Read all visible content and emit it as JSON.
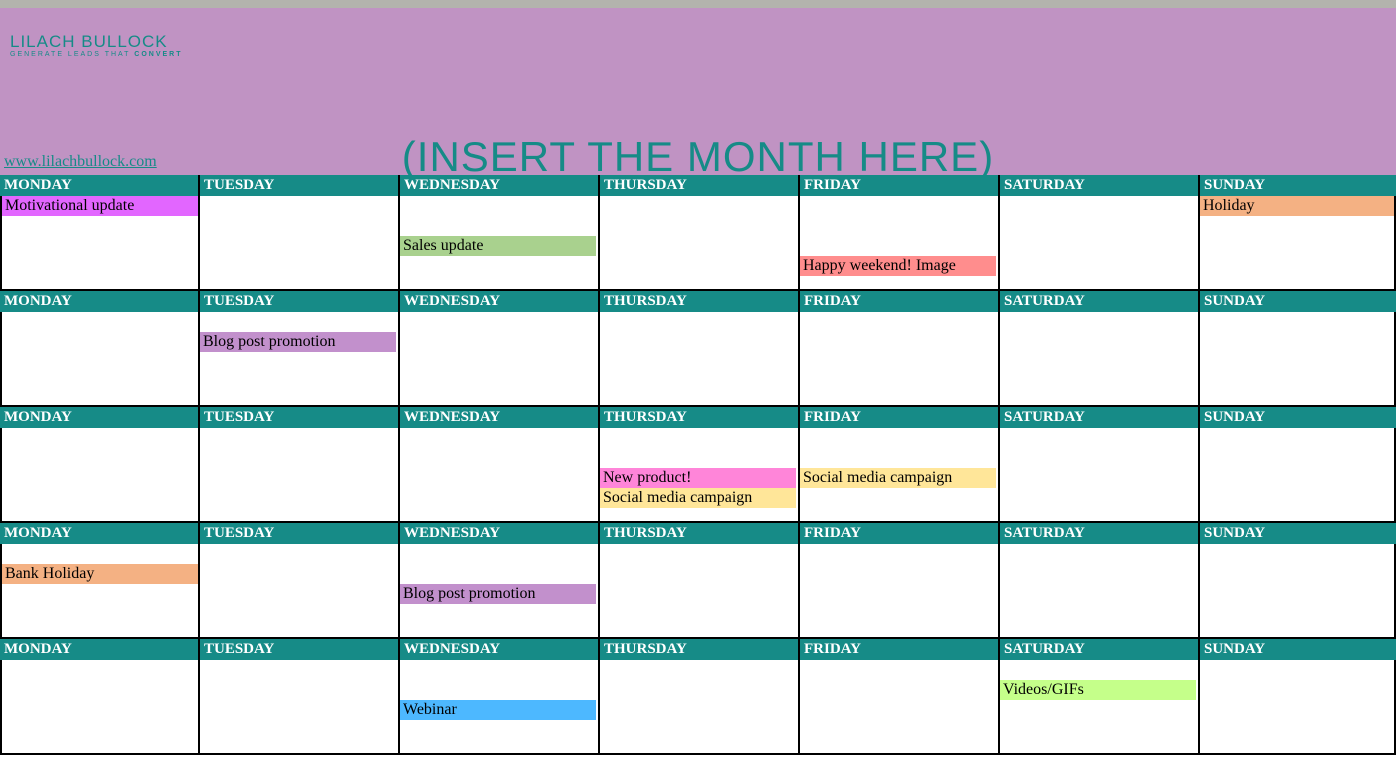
{
  "brand": {
    "name": "LILACH BULLOCK",
    "tagline_a": "GENERATE LEADS THAT ",
    "tagline_b": "CONVERT",
    "url": "www.lilachbullock.com"
  },
  "title": "(INSERT THE MONTH HERE)",
  "days": [
    "MONDAY",
    "TUESDAY",
    "WEDNESDAY",
    "THURSDAY",
    "FRIDAY",
    "SATURDAY",
    "SUNDAY"
  ],
  "weeks": [
    {
      "cells": [
        {
          "events": [
            {
              "label": "Motivational update",
              "color": "motivational",
              "slot": 0
            }
          ]
        },
        {
          "events": []
        },
        {
          "events": [
            {
              "label": "Sales update",
              "color": "sales",
              "slot": 2
            }
          ]
        },
        {
          "events": []
        },
        {
          "events": [
            {
              "label": "Happy weekend! Image",
              "color": "weekend",
              "slot": 3
            }
          ]
        },
        {
          "events": []
        },
        {
          "events": [
            {
              "label": "Holiday",
              "color": "holiday",
              "slot": 0
            }
          ]
        }
      ]
    },
    {
      "cells": [
        {
          "events": []
        },
        {
          "events": [
            {
              "label": "Blog post promotion",
              "color": "blog",
              "slot": 1
            }
          ]
        },
        {
          "events": []
        },
        {
          "events": []
        },
        {
          "events": []
        },
        {
          "events": []
        },
        {
          "events": []
        }
      ]
    },
    {
      "cells": [
        {
          "events": []
        },
        {
          "events": []
        },
        {
          "events": []
        },
        {
          "events": [
            {
              "label": "New product!",
              "color": "product",
              "slot": 2
            },
            {
              "label": "Social media campaign",
              "color": "campaign",
              "slot": 3
            }
          ]
        },
        {
          "events": [
            {
              "label": "Social media campaign",
              "color": "campaign",
              "slot": 2
            }
          ]
        },
        {
          "events": []
        },
        {
          "events": []
        }
      ]
    },
    {
      "cells": [
        {
          "events": [
            {
              "label": "Bank Holiday",
              "color": "holiday",
              "slot": 1
            }
          ]
        },
        {
          "events": []
        },
        {
          "events": [
            {
              "label": "Blog post promotion",
              "color": "blog",
              "slot": 2
            }
          ]
        },
        {
          "events": []
        },
        {
          "events": []
        },
        {
          "events": []
        },
        {
          "events": []
        }
      ]
    },
    {
      "cells": [
        {
          "events": []
        },
        {
          "events": []
        },
        {
          "events": [
            {
              "label": "Webinar",
              "color": "webinar",
              "slot": 2
            }
          ]
        },
        {
          "events": []
        },
        {
          "events": []
        },
        {
          "events": [
            {
              "label": "Videos/GIFs",
              "color": "video",
              "slot": 1
            }
          ]
        },
        {
          "events": []
        }
      ]
    }
  ]
}
